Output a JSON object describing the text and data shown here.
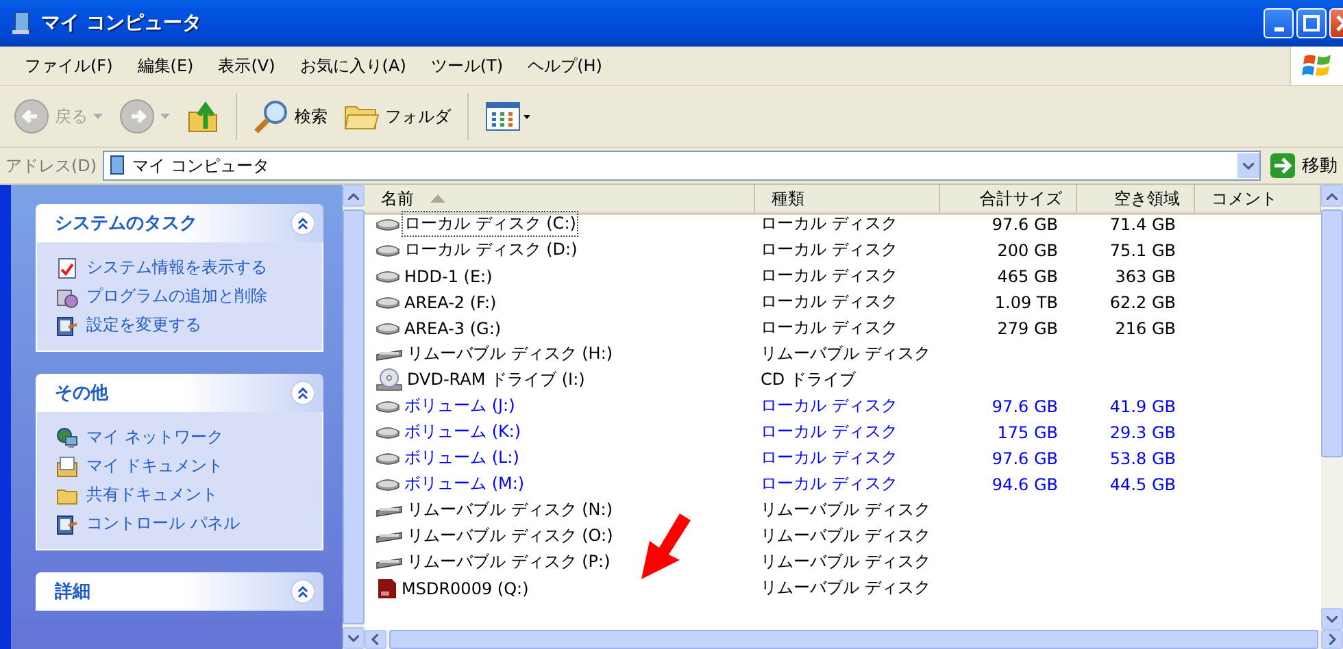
{
  "window": {
    "title": "マイ コンピュータ"
  },
  "menu": [
    "ファイル(F)",
    "編集(E)",
    "表示(V)",
    "お気に入り(A)",
    "ツール(T)",
    "ヘルプ(H)"
  ],
  "toolbar": [
    {
      "kind": "back",
      "label": "戻る",
      "disabled": true
    },
    {
      "kind": "forward",
      "disabled": true
    },
    {
      "kind": "up",
      "disabled": false
    },
    {
      "kind": "search",
      "label": "検索",
      "disabled": false
    },
    {
      "kind": "folders",
      "label": "フォルダ",
      "disabled": false
    },
    {
      "kind": "views",
      "disabled": false
    }
  ],
  "address": {
    "label": "アドレス(D)",
    "value": "マイ コンピュータ",
    "go": "移動"
  },
  "sidebar": [
    {
      "title": "システムのタスク",
      "expanded": true,
      "items": [
        {
          "kind": "info",
          "label": "システム情報を表示する"
        },
        {
          "kind": "programs",
          "label": "プログラムの追加と削除"
        },
        {
          "kind": "settings",
          "label": "設定を変更する"
        }
      ]
    },
    {
      "title": "その他",
      "expanded": true,
      "items": [
        {
          "kind": "network",
          "label": "マイ ネットワーク"
        },
        {
          "kind": "documents",
          "label": "マイ ドキュメント"
        },
        {
          "kind": "folder",
          "label": "共有ドキュメント"
        },
        {
          "kind": "settings",
          "label": "コントロール パネル"
        }
      ]
    },
    {
      "title": "詳細",
      "expanded": true
    }
  ],
  "table": {
    "columns": [
      {
        "label": "名前",
        "sorted": true
      },
      {
        "label": "種類",
        "sorted": false
      },
      {
        "label": "合計サイズ",
        "sorted": false
      },
      {
        "label": "空き領域",
        "sorted": false
      },
      {
        "label": "コメント",
        "sorted": false
      }
    ],
    "rows": [
      {
        "kind": "hdd",
        "name": "ローカル ディスク (C:)",
        "type": "ローカル ディスク",
        "total": "97.6 GB",
        "free": "71.4 GB",
        "compressed": false,
        "focused": true
      },
      {
        "kind": "hdd",
        "name": "ローカル ディスク (D:)",
        "type": "ローカル ディスク",
        "total": "200 GB",
        "free": "75.1 GB",
        "compressed": false,
        "focused": false
      },
      {
        "kind": "hdd",
        "name": "HDD-1 (E:)",
        "type": "ローカル ディスク",
        "total": "465 GB",
        "free": "363 GB",
        "compressed": false,
        "focused": false
      },
      {
        "kind": "hdd",
        "name": "AREA-2 (F:)",
        "type": "ローカル ディスク",
        "total": "1.09 TB",
        "free": "62.2 GB",
        "compressed": false,
        "focused": false
      },
      {
        "kind": "hdd",
        "name": "AREA-3 (G:)",
        "type": "ローカル ディスク",
        "total": "279 GB",
        "free": "216 GB",
        "compressed": false,
        "focused": false
      },
      {
        "kind": "removable",
        "name": "リムーバブル ディスク (H:)",
        "type": "リムーバブル ディスク",
        "compressed": false,
        "focused": false
      },
      {
        "kind": "dvd",
        "name": "DVD-RAM ドライブ (I:)",
        "type": "CD ドライブ",
        "compressed": false,
        "focused": false
      },
      {
        "kind": "hdd",
        "name": "ボリューム (J:)",
        "type": "ローカル ディスク",
        "total": "97.6 GB",
        "free": "41.9 GB",
        "compressed": true,
        "focused": false
      },
      {
        "kind": "hdd",
        "name": "ボリューム (K:)",
        "type": "ローカル ディスク",
        "total": "175 GB",
        "free": "29.3 GB",
        "compressed": true,
        "focused": false
      },
      {
        "kind": "hdd",
        "name": "ボリューム (L:)",
        "type": "ローカル ディスク",
        "total": "97.6 GB",
        "free": "53.8 GB",
        "compressed": true,
        "focused": false
      },
      {
        "kind": "hdd",
        "name": "ボリューム (M:)",
        "type": "ローカル ディスク",
        "total": "94.6 GB",
        "free": "44.5 GB",
        "compressed": true,
        "focused": false
      },
      {
        "kind": "removable",
        "name": "リムーバブル ディスク (N:)",
        "type": "リムーバブル ディスク",
        "compressed": false,
        "focused": false
      },
      {
        "kind": "removable",
        "name": "リムーバブル ディスク (O:)",
        "type": "リムーバブル ディスク",
        "compressed": false,
        "focused": false
      },
      {
        "kind": "removable",
        "name": "リムーバブル ディスク (P:)",
        "type": "リムーバブル ディスク",
        "compressed": false,
        "focused": false
      },
      {
        "kind": "sd",
        "name": "MSDR0009 (Q:)",
        "type": "リムーバブル ディスク",
        "compressed": false,
        "focused": false
      }
    ]
  },
  "pointer_arrow": {
    "visible": true
  }
}
